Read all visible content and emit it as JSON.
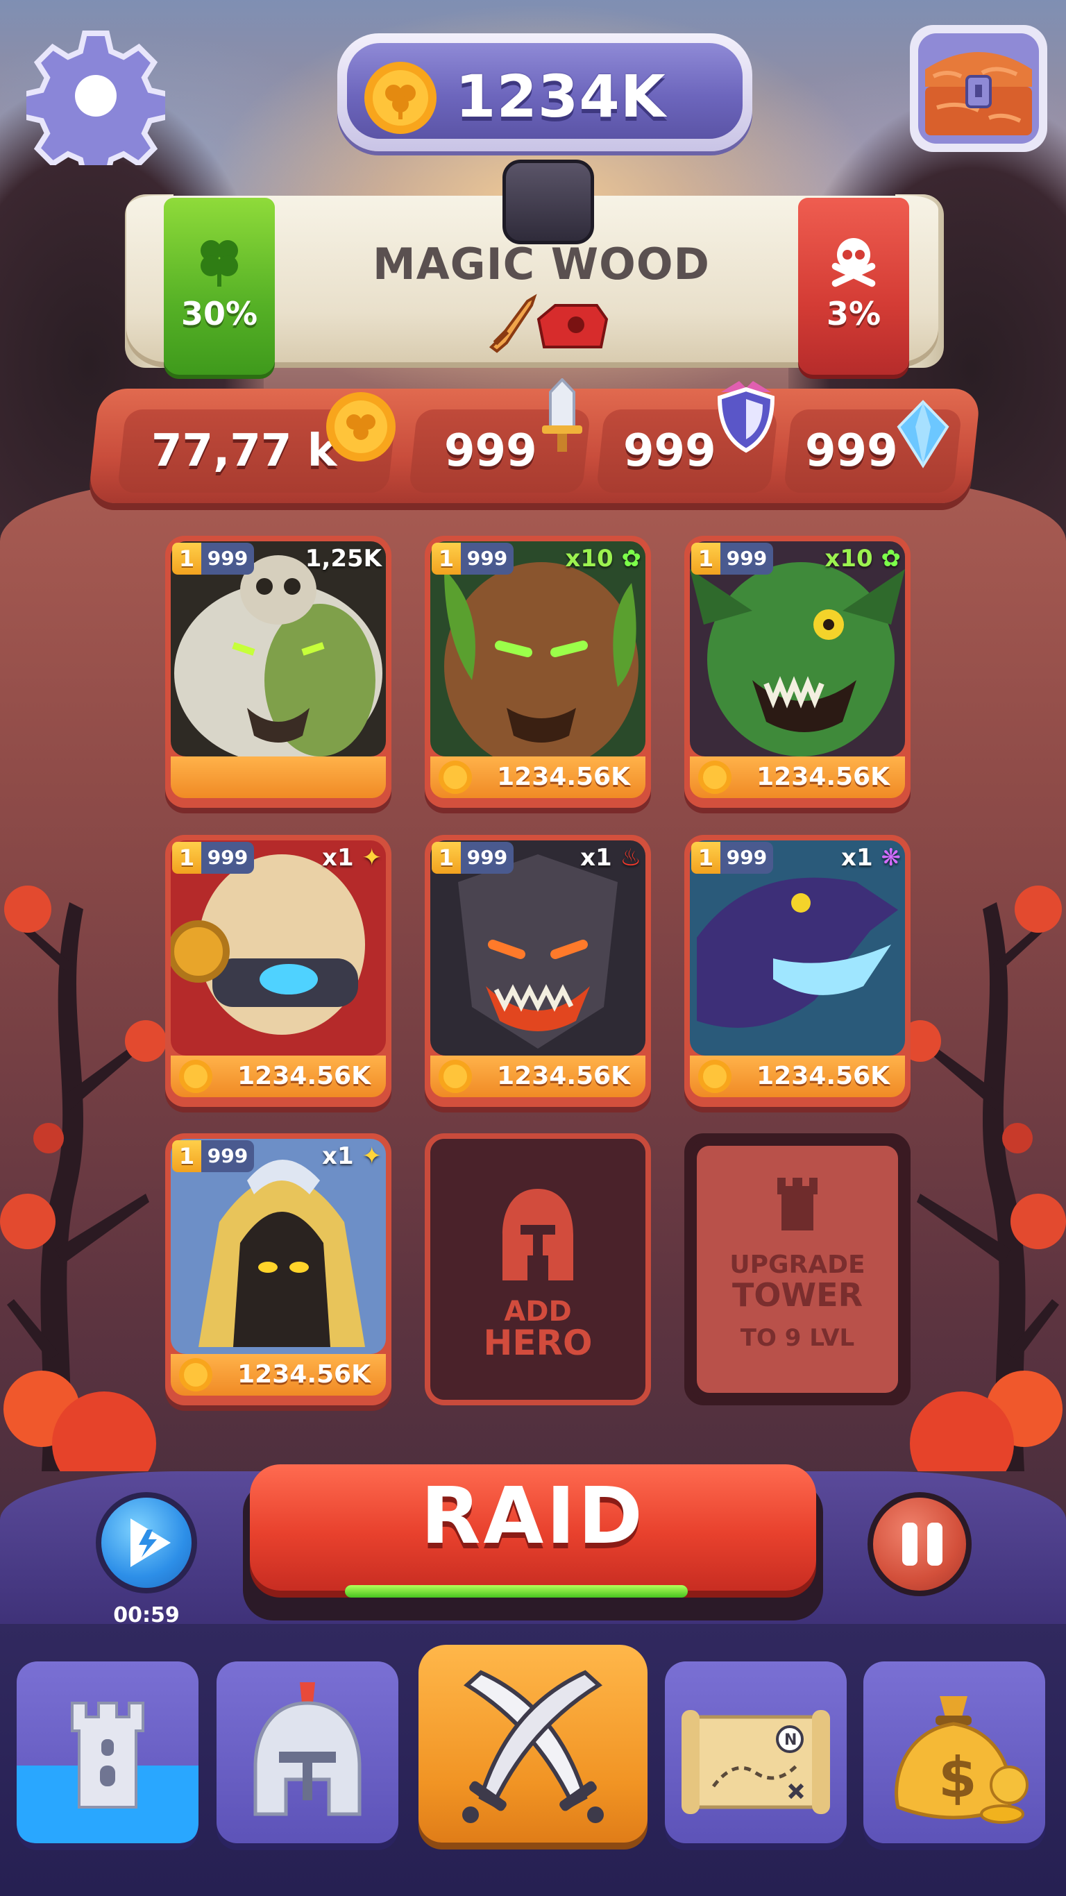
{
  "header": {
    "coins": "1234K"
  },
  "banner": {
    "title": "MAGIC WOOD",
    "luck_percent": "30%",
    "danger_percent": "3%"
  },
  "stats": {
    "gold": "77,77 k",
    "attack": "999",
    "defense": "999",
    "gems": "999"
  },
  "cards": [
    {
      "level": "1",
      "power": "999",
      "mult": "1,25K",
      "mult_prefix": "",
      "price": ""
    },
    {
      "level": "1",
      "power": "999",
      "mult": "10",
      "mult_prefix": "x",
      "price": "1234.56K"
    },
    {
      "level": "1",
      "power": "999",
      "mult": "10",
      "mult_prefix": "x",
      "price": "1234.56K"
    },
    {
      "level": "1",
      "power": "999",
      "mult": "1",
      "mult_prefix": "x",
      "price": "1234.56K"
    },
    {
      "level": "1",
      "power": "999",
      "mult": "1",
      "mult_prefix": "x",
      "price": "1234.56K"
    },
    {
      "level": "1",
      "power": "999",
      "mult": "1",
      "mult_prefix": "x",
      "price": "1234.56K"
    },
    {
      "level": "1",
      "power": "999",
      "mult": "1",
      "mult_prefix": "x",
      "price": "1234.56K"
    }
  ],
  "add_slot": {
    "line1": "ADD",
    "line2": "HERO"
  },
  "upgrade_slot": {
    "line1": "UPGRADE",
    "line2": "TOWER",
    "line3": "TO 9 LVL"
  },
  "raid": {
    "label": "RAID",
    "progress": 1.0
  },
  "ad_timer": "00:59",
  "nav": {
    "items": [
      "tower-icon",
      "helmet-icon",
      "crossed-swords-icon",
      "map-icon",
      "money-bag-icon"
    ],
    "active": "crossed-swords-icon"
  },
  "colors": {
    "accent_orange": "#f08a25",
    "raid_red": "#e8412d",
    "nav_purple": "#6d64c6",
    "luck_green": "#56b126",
    "danger_red": "#d43c35"
  }
}
